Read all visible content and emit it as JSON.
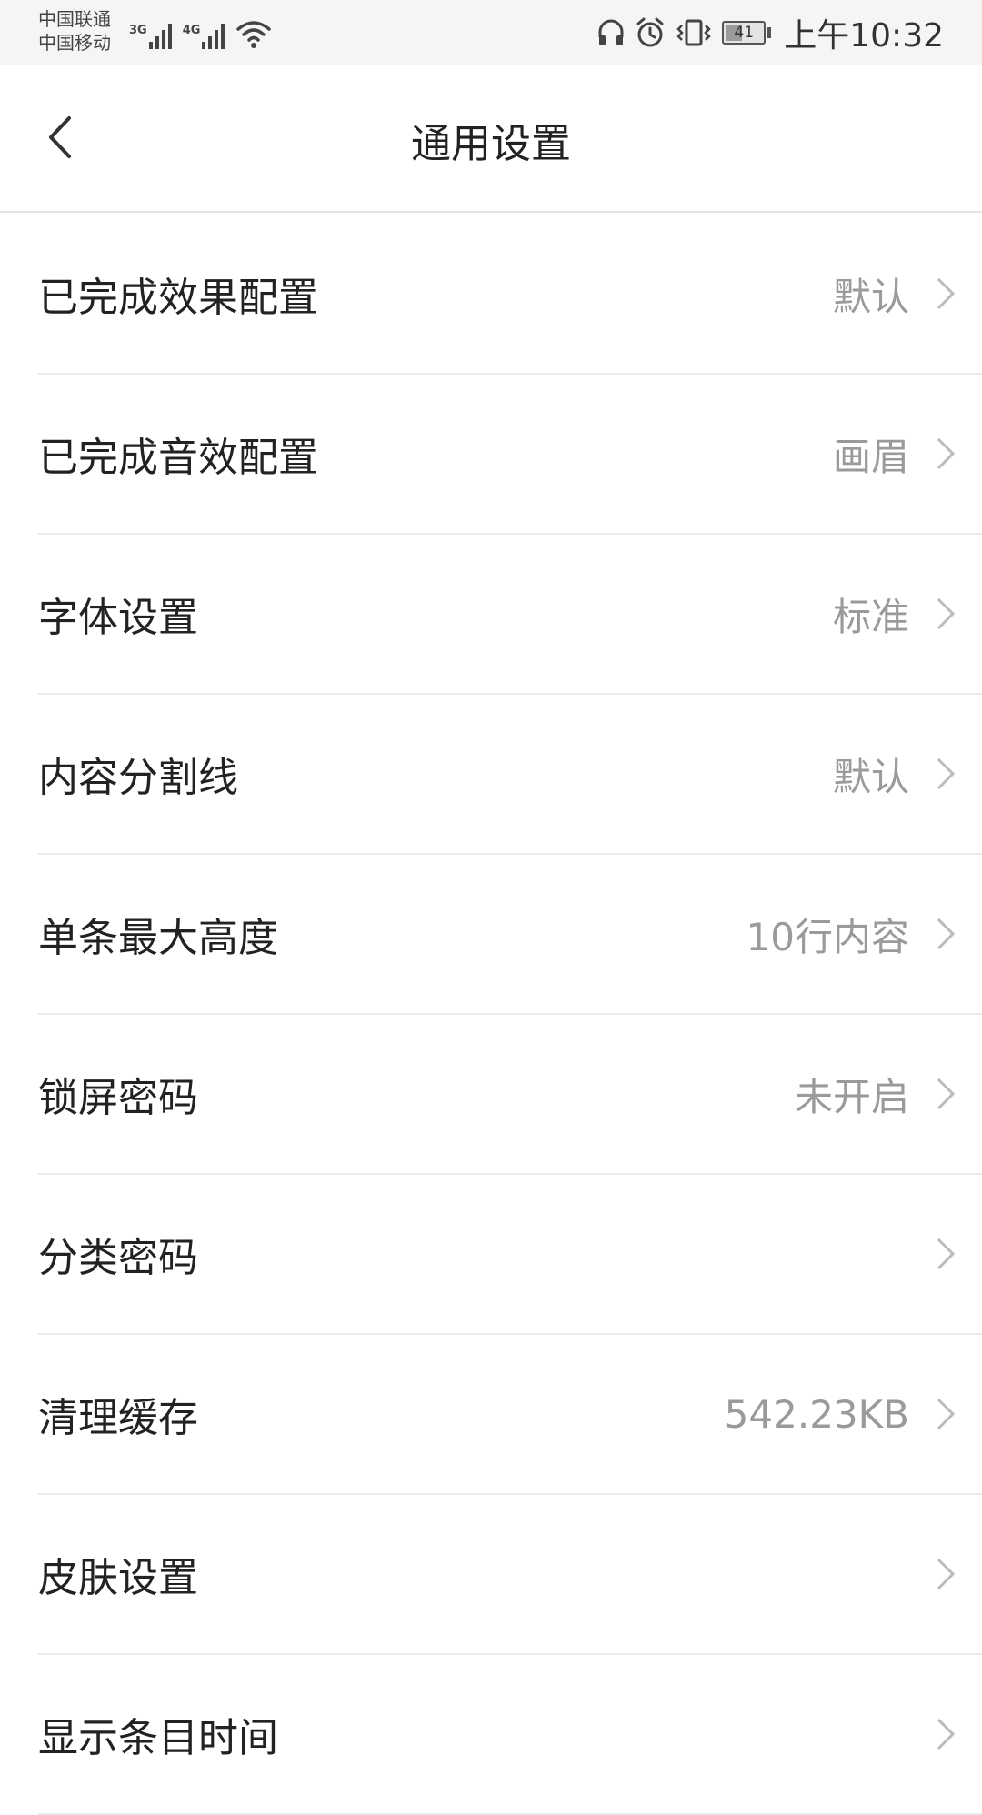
{
  "status_bar": {
    "carrier_1": "中国联通",
    "carrier_2": "中国移动",
    "network_1": "3G",
    "network_2": "4G",
    "battery_level": "41",
    "time": "上午10:32",
    "icons": [
      "headset-icon",
      "alarm-icon",
      "vibrate-icon",
      "battery-icon",
      "wifi-icon"
    ]
  },
  "header": {
    "title": "通用设置",
    "back_icon": "chevron-left-icon"
  },
  "settings": [
    {
      "label": "已完成效果配置",
      "value": "默认"
    },
    {
      "label": "已完成音效配置",
      "value": "画眉"
    },
    {
      "label": "字体设置",
      "value": "标准"
    },
    {
      "label": "内容分割线",
      "value": "默认"
    },
    {
      "label": "单条最大高度",
      "value": "10行内容"
    },
    {
      "label": "锁屏密码",
      "value": "未开启"
    },
    {
      "label": "分类密码",
      "value": ""
    },
    {
      "label": "清理缓存",
      "value": "542.23KB"
    },
    {
      "label": "皮肤设置",
      "value": ""
    },
    {
      "label": "显示条目时间",
      "value": ""
    }
  ],
  "colors": {
    "status_bar_bg": "#f5f5f5",
    "text_primary": "#222222",
    "text_secondary": "#9a9a9a",
    "divider": "#ebebeb",
    "chevron": "#bbbbbb"
  }
}
